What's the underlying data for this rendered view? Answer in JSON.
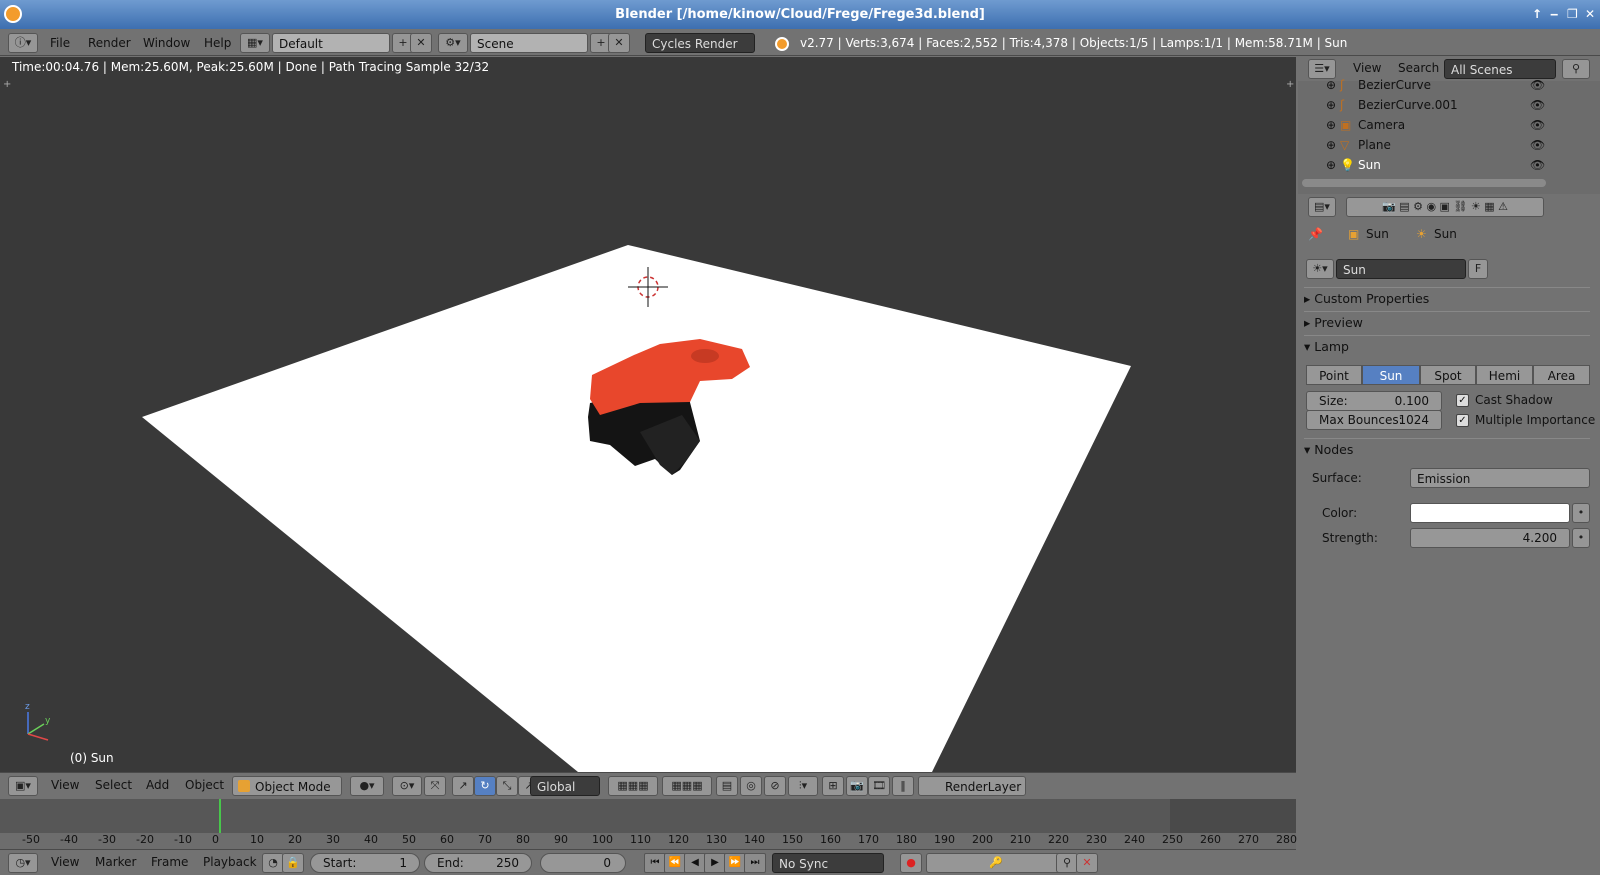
{
  "window": {
    "title": "Blender [/home/kinow/Cloud/Frege/Frege3d.blend]",
    "controls": [
      "↑",
      "‒",
      "❐",
      "✕"
    ]
  },
  "topbar": {
    "menus": [
      "File",
      "Render",
      "Window",
      "Help"
    ],
    "layout": "Default",
    "scene": "Scene",
    "engine": "Cycles Render",
    "stats": "v2.77 | Verts:3,674 | Faces:2,552 | Tris:4,378 | Objects:1/5 | Lamps:1/1 | Mem:58.71M | Sun"
  },
  "viewport": {
    "render_info": "Time:00:04.76 | Mem:25.60M, Peak:25.60M | Done | Path Tracing Sample 32/32",
    "object_label": "(0) Sun"
  },
  "header3d": {
    "menus": [
      "View",
      "Select",
      "Add",
      "Object"
    ],
    "mode": "Object Mode",
    "orientation": "Global",
    "render_layer": "RenderLayer"
  },
  "timeline": {
    "ticks": [
      "-50",
      "-40",
      "-30",
      "-20",
      "-10",
      "0",
      "10",
      "20",
      "30",
      "40",
      "50",
      "60",
      "70",
      "80",
      "90",
      "100",
      "110",
      "120",
      "130",
      "140",
      "150",
      "160",
      "170",
      "180",
      "190",
      "200",
      "210",
      "220",
      "230",
      "240",
      "250",
      "260",
      "270",
      "280"
    ],
    "current_frame": 0
  },
  "bottombar": {
    "menus": [
      "View",
      "Marker",
      "Frame",
      "Playback"
    ],
    "start_label": "Start:",
    "start_value": "1",
    "end_label": "End:",
    "end_value": "250",
    "frame_value": "0",
    "sync": "No Sync"
  },
  "outliner": {
    "menus": [
      "View",
      "Search"
    ],
    "filter": "All Scenes",
    "items": [
      {
        "label": "BezierCurve"
      },
      {
        "label": "BezierCurve.001"
      },
      {
        "label": "Camera"
      },
      {
        "label": "Plane"
      },
      {
        "label": "Sun"
      }
    ]
  },
  "properties": {
    "breadcrumb_object": "Sun",
    "breadcrumb_data": "Sun",
    "datablock_name": "Sun",
    "fake_user": "F",
    "panels": {
      "custom_properties": "Custom Properties",
      "preview": "Preview",
      "lamp": "Lamp",
      "nodes": "Nodes"
    },
    "lamp_types": [
      "Point",
      "Sun",
      "Spot",
      "Hemi",
      "Area"
    ],
    "active_lamp_type": "Sun",
    "size_label": "Size:",
    "size_value": "0.100",
    "bounces_label": "Max Bounces:",
    "bounces_value": "1024",
    "cast_shadow": "Cast Shadow",
    "multiple_importance": "Multiple Importance",
    "surface_label": "Surface:",
    "surface_value": "Emission",
    "color_label": "Color:",
    "color_value": "#ffffff",
    "strength_label": "Strength:",
    "strength_value": "4.200"
  },
  "colors": {
    "accent": "#5680c2",
    "object_red": "#e8472c",
    "timeline_marker": "#48c74b"
  }
}
